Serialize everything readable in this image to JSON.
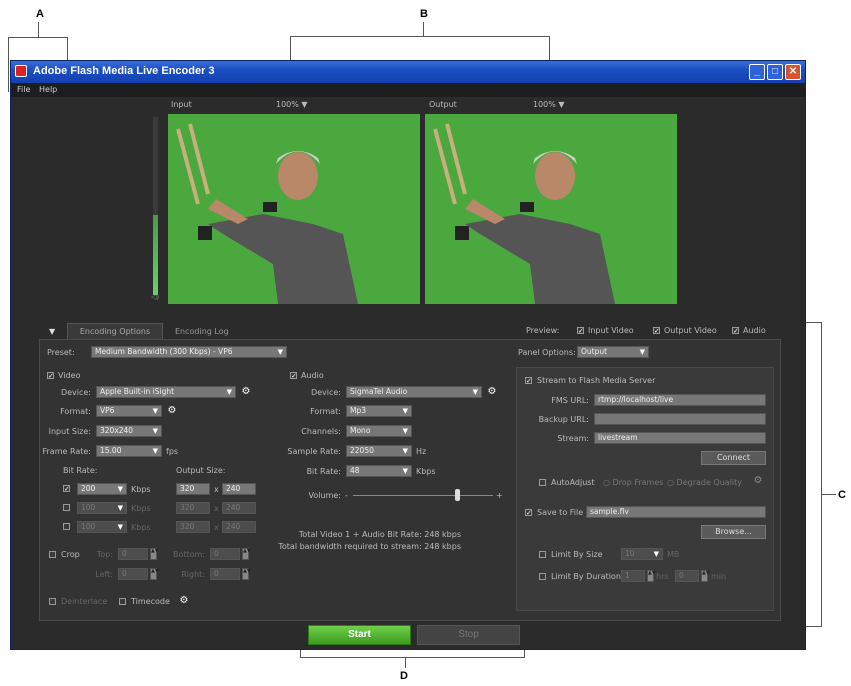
{
  "callouts": {
    "a": "A",
    "b": "B",
    "c": "C",
    "d": "D"
  },
  "window": {
    "title": "Adobe Flash Media Live Encoder 3"
  },
  "menu": [
    "File",
    "Help"
  ],
  "preview": {
    "input_label": "Input",
    "input_zoom": "100%",
    "output_label": "Output",
    "output_zoom": "100%"
  },
  "tabs": {
    "encoding_options": "Encoding Options",
    "encoding_log": "Encoding Log"
  },
  "preview_opts": {
    "label": "Preview:",
    "input": "Input Video",
    "output": "Output Video",
    "audio": "Audio"
  },
  "preset": {
    "label": "Preset:",
    "value": "Medium Bandwidth (300 Kbps) - VP6"
  },
  "video": {
    "header": "Video",
    "device_label": "Device:",
    "device": "Apple Built-in iSight",
    "format_label": "Format:",
    "format": "VP6",
    "input_size_label": "Input Size:",
    "input_size": "320x240",
    "frame_rate_label": "Frame Rate:",
    "frame_rate": "15.00",
    "fps": "fps",
    "bit_rate_label": "Bit Rate:",
    "output_size_label": "Output Size:",
    "rows": [
      {
        "rate": "200",
        "unit": "Kbps",
        "w": "320",
        "x": "x",
        "h": "240"
      },
      {
        "rate": "100",
        "unit": "Kbps",
        "w": "320",
        "x": "x",
        "h": "240"
      },
      {
        "rate": "100",
        "unit": "Kbps",
        "w": "320",
        "x": "x",
        "h": "240"
      }
    ],
    "crop": "Crop",
    "top": "Top:",
    "top_val": "0",
    "bottom": "Bottom:",
    "bottom_val": "0",
    "left": "Left:",
    "left_val": "0",
    "right": "Right:",
    "right_val": "0",
    "deinterlace": "Deinterlace",
    "timecode": "Timecode"
  },
  "audio": {
    "header": "Audio",
    "device_label": "Device:",
    "device": "SigmaTel Audio",
    "format_label": "Format:",
    "format": "Mp3",
    "channels_label": "Channels:",
    "channels": "Mono",
    "sample_rate_label": "Sample Rate:",
    "sample_rate": "22050",
    "hz": "Hz",
    "bit_rate_label": "Bit Rate:",
    "bit_rate": "48",
    "kbps": "Kbps",
    "volume_label": "Volume:",
    "volume_min": "-",
    "volume_max": "+",
    "volume_level": 0.75,
    "total1": "Total Video 1 + Audio Bit Rate:  248 kbps",
    "total2": "Total bandwidth required to stream:  248 kbps"
  },
  "panel": {
    "options_label": "Panel Options:",
    "options_value": "Output",
    "stream": "Stream to Flash Media Server",
    "fms_label": "FMS URL:",
    "fms_value": "rtmp://localhost/live",
    "backup_label": "Backup URL:",
    "backup_value": "",
    "stream_label": "Stream:",
    "stream_value": "livestream",
    "connect": "Connect",
    "autoadjust": "AutoAdjust",
    "drop_frames": "Drop Frames",
    "degrade_quality": "Degrade Quality",
    "save_to_file": "Save to File",
    "file_value": "sample.flv",
    "browse": "Browse...",
    "limit_size": "Limit By Size",
    "size_value": "10",
    "mb": "MB",
    "limit_duration": "Limit By Duration",
    "hrs_value": "1",
    "hrs": "hrs",
    "min_value": "0",
    "min": "min"
  },
  "buttons": {
    "start": "Start",
    "stop": "Stop"
  },
  "colors": {
    "start_green": "#4caf2f",
    "title_blue": "#1a4fc3",
    "panel_bg": "#2b2b2b"
  }
}
